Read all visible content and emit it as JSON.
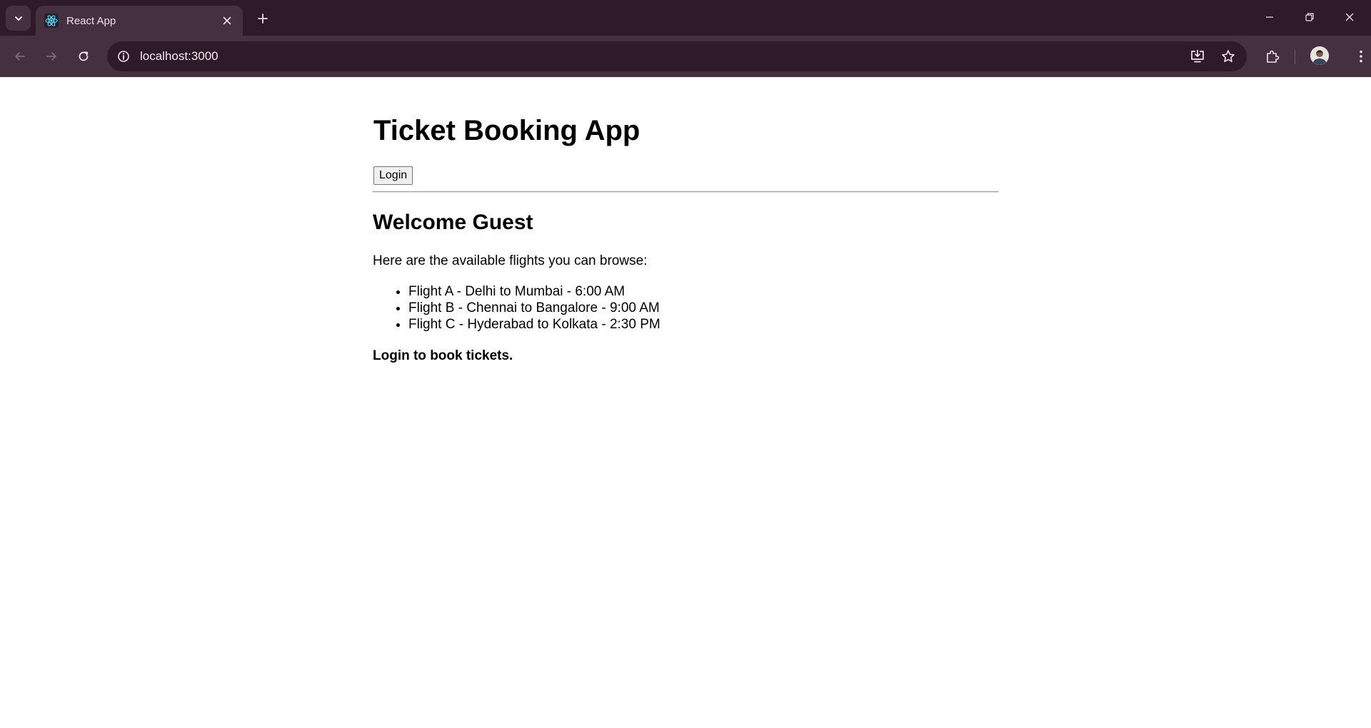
{
  "browser": {
    "tab_title": "React App",
    "url": "localhost:3000",
    "colors": {
      "tabstrip": "#2f1a2a",
      "toolbar": "#45303f",
      "omnibox": "#2f1a2a"
    }
  },
  "page": {
    "title": "Ticket Booking App",
    "login_label": "Login",
    "welcome_heading": "Welcome Guest",
    "intro": "Here are the available flights you can browse:",
    "flights": [
      "Flight A - Delhi to Mumbai - 6:00 AM",
      "Flight B - Chennai to Bangalore - 9:00 AM",
      "Flight C - Hyderabad to Kolkata - 2:30 PM"
    ],
    "cta": "Login to book tickets."
  },
  "icons": {
    "tab_search": "chevron-down-icon",
    "favicon": "react-logo-icon",
    "tab_close": "close-icon",
    "new_tab": "plus-icon",
    "minimize": "minimize-icon",
    "restore": "restore-icon",
    "close_window": "close-icon",
    "back": "back-arrow-icon",
    "forward": "forward-arrow-icon",
    "reload": "reload-icon",
    "site_info": "info-icon",
    "install": "install-app-icon",
    "bookmark": "star-icon",
    "extensions": "puzzle-icon",
    "profile": "avatar",
    "menu": "kebab-menu-icon"
  }
}
